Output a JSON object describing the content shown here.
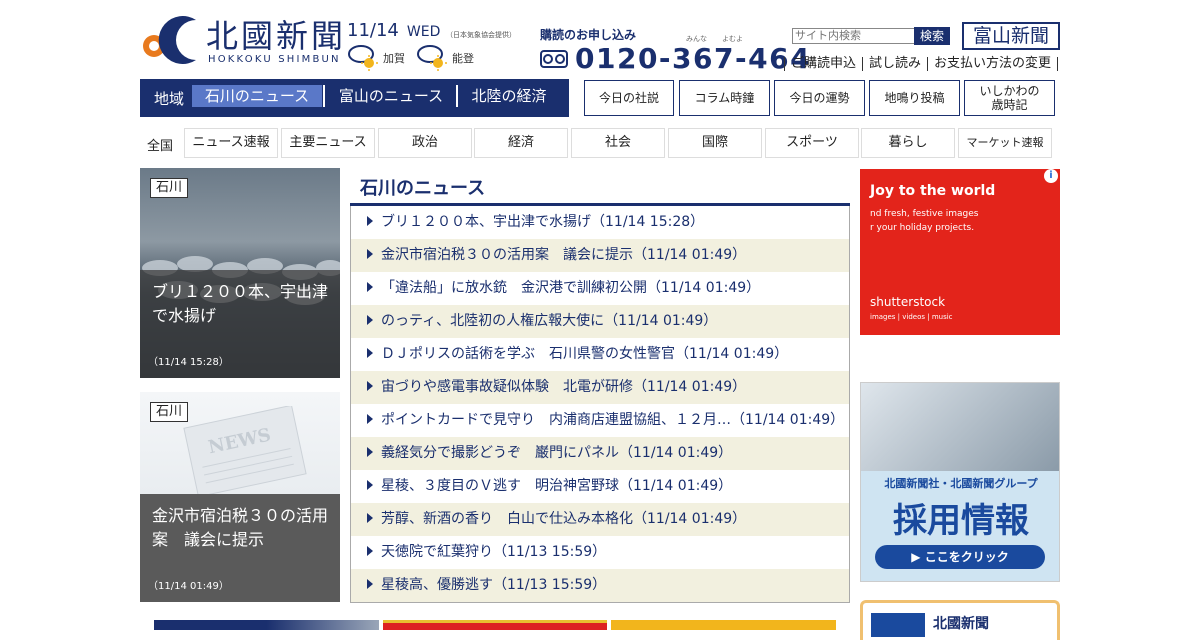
{
  "header": {
    "logo_jp": "北國新聞",
    "logo_en": "HOKKOKU SHIMBUN",
    "date": "11/14",
    "weekday": "WED",
    "weather_source": "（日本気象協会提供）",
    "weather": [
      {
        "area": "加賀",
        "icon": "cloud-sun-icon"
      },
      {
        "area": "能登",
        "icon": "cloud-sun-icon"
      }
    ],
    "subscribe_title": "購読のお申し込み",
    "ruby": [
      "みんな",
      "よむよ"
    ],
    "phone": "0120-367-464",
    "search_placeholder": "サイト内検索",
    "search_button": "検索",
    "toyama_button": "富山新聞",
    "top_links": [
      "ご購読申込",
      "試し読み",
      "お支払い方法の変更"
    ]
  },
  "region_nav": {
    "label": "地域",
    "tabs": [
      {
        "label": "石川のニュース",
        "active": true
      },
      {
        "label": "富山のニュース",
        "active": false
      },
      {
        "label": "北陸の経済",
        "active": false
      }
    ]
  },
  "feature_buttons": [
    "今日の社説",
    "コラム時鐘",
    "今日の運勢",
    "地鳴り投稿",
    "いしかわの\n歳時記"
  ],
  "category_nav": {
    "all_label": "全国",
    "items": [
      "ニュース速報",
      "主要ニュース",
      "政治",
      "経済",
      "社会",
      "国際",
      "スポーツ",
      "暮らし",
      "マーケット速報"
    ]
  },
  "cards": [
    {
      "badge": "石川",
      "title": "ブリ１２００本、宇出津で水揚げ",
      "time": "（11/14 15:28）"
    },
    {
      "badge": "石川",
      "title": "金沢市宿泊税３０の活用案　議会に提示",
      "time": "（11/14 01:49）"
    }
  ],
  "news": {
    "heading": "石川のニュース",
    "items": [
      "ブリ１２００本、宇出津で水揚げ（11/14 15:28）",
      "金沢市宿泊税３０の活用案　議会に提示（11/14 01:49）",
      "「違法船」に放水銃　金沢港で訓練初公開（11/14 01:49）",
      "のっティ、北陸初の人権広報大使に（11/14 01:49）",
      "ＤＪポリスの話術を学ぶ　石川県警の女性警官（11/14 01:49）",
      "宙づりや感電事故疑似体験　北電が研修（11/14 01:49）",
      "ポイントカードで見守り　内浦商店連盟協組、１２月…（11/14 01:49）",
      "義経気分で撮影どうぞ　巌門にパネル（11/14 01:49）",
      "星稜、３度目のＶ逃す　明治神宮野球（11/14 01:49）",
      "芳醇、新酒の香り　白山で仕込み本格化（11/14 01:49）",
      "天徳院で紅葉狩り（11/13 15:59）",
      "星稜高、優勝逃す（11/13 15:59）"
    ]
  },
  "ads": {
    "shutterstock": {
      "headline": "Joy to the world",
      "sub1": "nd fresh, festive images",
      "sub2": "r your holiday projects.",
      "brand": "shutterstock",
      "tagline": "images  |  videos  |  music"
    },
    "recruit": {
      "line1": "北國新聞社・北國新聞グループ",
      "line2": "採用情報",
      "button": "▶ ここをクリック"
    },
    "bottom": {
      "title": "北國新聞"
    }
  },
  "colors": {
    "brand_navy": "#1a2f6e",
    "active_tab": "#5a78c8",
    "row_alt": "#f2f0df",
    "ad_red": "#e3241b"
  }
}
